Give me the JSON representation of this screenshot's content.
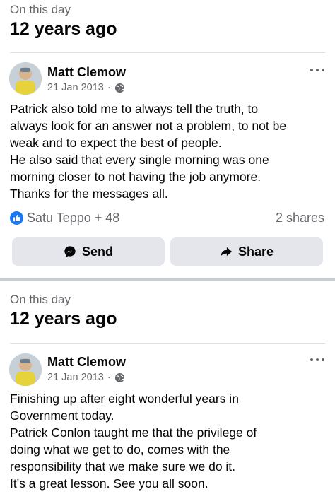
{
  "memories": [
    {
      "label": "On this day",
      "time_ago": "12 years ago",
      "post": {
        "author": "Matt Clemow",
        "date": "21 Jan 2013",
        "privacy_icon": "globe-icon",
        "text_lines": [
          "Patrick also told me to always tell the truth, to",
          "always look for an answer not a problem, to not be",
          "weak and to expect the best of people.",
          "He also said that every single morning was one",
          "morning closer to not having the job anymore.",
          "Thanks for the messages all."
        ],
        "reactions": "Satu Teppo + 48",
        "shares": "2 shares"
      },
      "actions": {
        "send_label": "Send",
        "share_label": "Share"
      }
    },
    {
      "label": "On this day",
      "time_ago": "12 years ago",
      "post": {
        "author": "Matt Clemow",
        "date": "21 Jan 2013",
        "privacy_icon": "globe-icon",
        "text_lines": [
          "Finishing up after eight wonderful years in",
          "Government today.",
          "Patrick Conlon taught me that the privilege of",
          "doing what we get to do, comes with the",
          "responsibility that we make sure we do it.",
          "It's a great lesson. See you all soon."
        ]
      }
    }
  ],
  "colors": {
    "like_blue": "#1877f2",
    "secondary_text": "#65676b",
    "button_bg": "#e4e6eb"
  }
}
